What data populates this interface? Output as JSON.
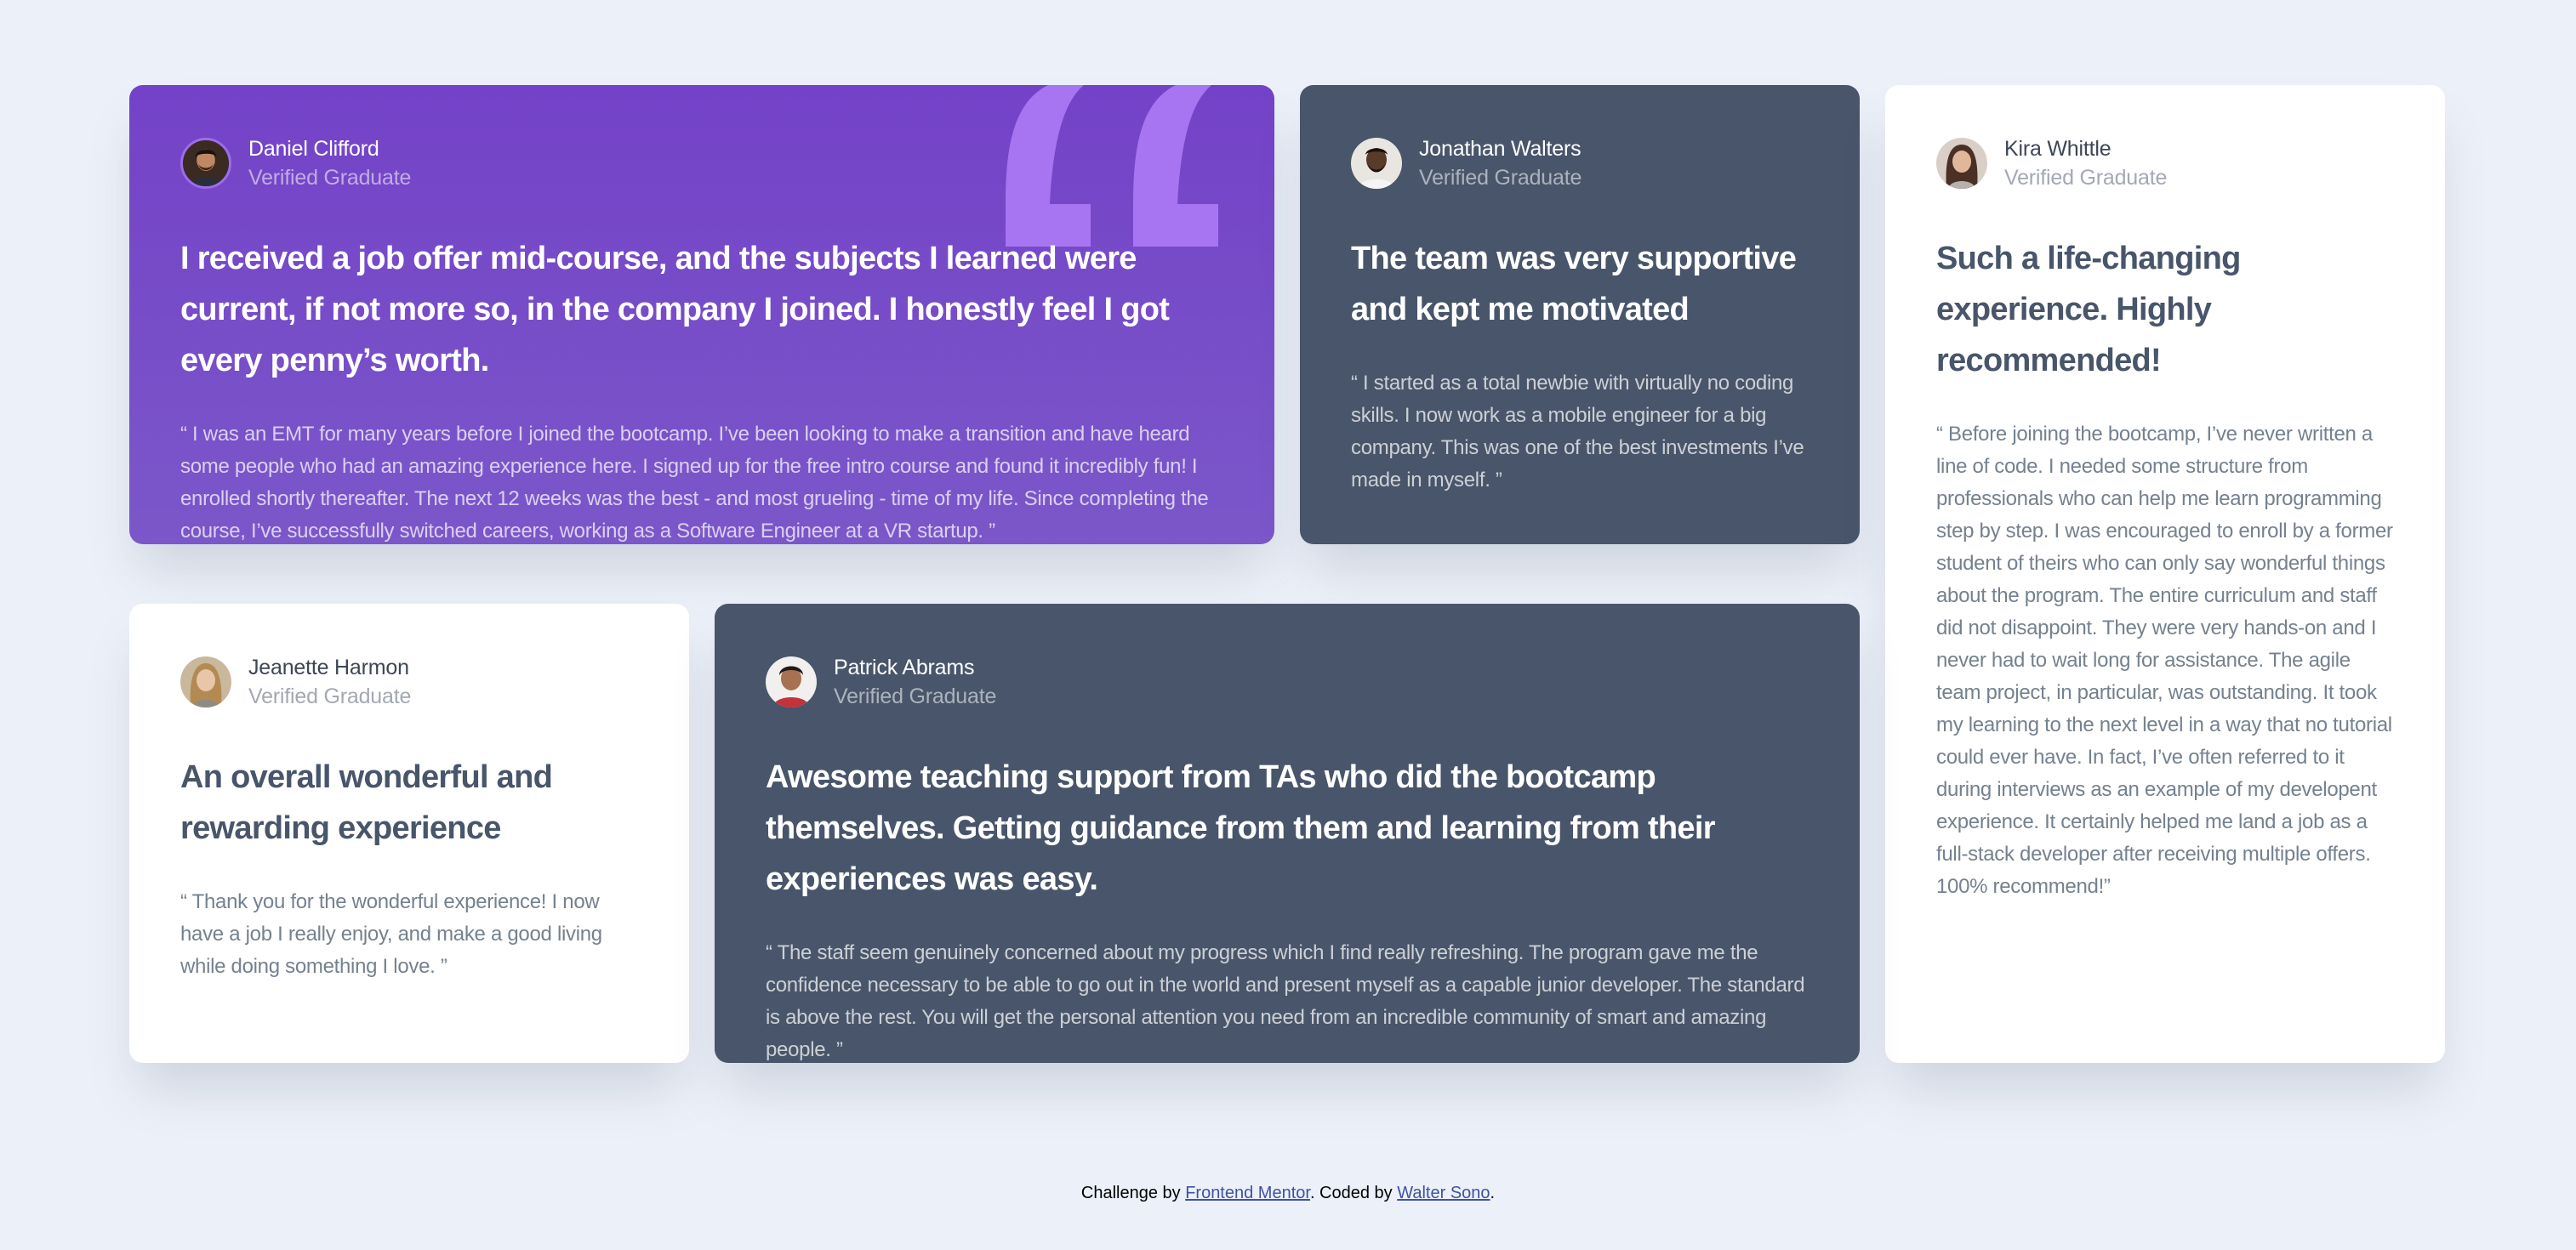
{
  "testimonials": [
    {
      "name": "Daniel Clifford",
      "role": "Verified Graduate",
      "headline": "I received a job offer mid-course, and the subjects I learned were current, if not more so, in the company I joined. I honestly feel I got every penny’s worth.",
      "body": "“ I was an EMT for many years before I joined the bootcamp. I’ve been looking to make a transition and have heard some people who had an amazing experience here. I signed up for the free intro course and found it incredibly fun! I enrolled shortly thereafter. The next 12 weeks was the best - and most grueling - time of my life. Since completing the course, I’ve successfully switched careers, working as a Software Engineer at a VR startup. ”"
    },
    {
      "name": "Jonathan Walters",
      "role": "Verified Graduate",
      "headline": "The team was very supportive and kept me motivated",
      "body": "“ I started as a total newbie with virtually no coding skills. I now work as a mobile engineer for a big company. This was one of the best investments I’ve made in myself. ”"
    },
    {
      "name": "Kira Whittle",
      "role": "Verified Graduate",
      "headline": "Such a life-changing experience. Highly recommended!",
      "body": "“ Before joining the bootcamp, I’ve never written a line of code. I needed some structure from professionals who can help me learn programming step by step. I was encouraged to enroll by a former student of theirs who can only say wonderful things about the program. The entire curriculum and staff did not disappoint. They were very hands-on and I never had to wait long for assistance. The agile team project, in particular, was outstanding. It took my learning to the next level in a way that no tutorial could ever have. In fact, I’ve often referred to it during interviews as an example of my developent experience. It certainly helped me land a job as a full-stack developer after receiving multiple offers. 100% recommend!”"
    },
    {
      "name": "Jeanette Harmon",
      "role": "Verified Graduate",
      "headline": "An overall wonderful and rewarding experience",
      "body": "“ Thank you for the wonderful experience! I now have a job I really enjoy, and make a good living while doing something I love. ”"
    },
    {
      "name": "Patrick Abrams",
      "role": "Verified Graduate",
      "headline": "Awesome teaching support from TAs who did the bootcamp themselves. Getting guidance from them and learning from their experiences was easy.",
      "body": "“ The staff seem genuinely concerned about my progress which I find really refreshing. The program gave me the confidence necessary to be able to go out in the world and present myself as a capable junior developer. The standard is above the rest. You will get the personal attention you need from an incredible community of smart and amazing people. ”"
    }
  ],
  "footer": {
    "prefix": "Challenge by ",
    "link1": "Frontend Mentor",
    "middle": ". Coded by ",
    "link2": "Walter Sono",
    "suffix": "."
  },
  "colors": {
    "page_bg": "#ecf1f9",
    "purple": "#7541c8",
    "dark_blue": "#48556a",
    "white": "#ffffff",
    "quote_mark": "#a775f1",
    "link": "#3e52a3"
  },
  "icons": {
    "quote": "quotation-mark-icon"
  }
}
